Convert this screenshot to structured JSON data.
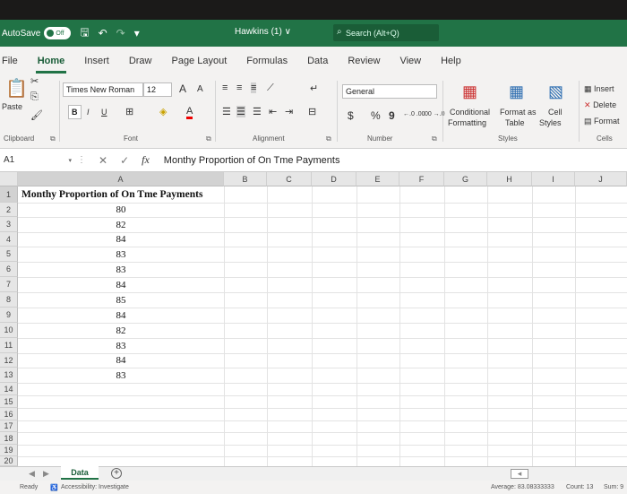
{
  "title_bar": {
    "autosave_label": "AutoSave",
    "autosave_state": "Off",
    "document_title": "Hawkins (1) ∨",
    "search_placeholder": "Search (Alt+Q)"
  },
  "ribbon_tabs": [
    "File",
    "Home",
    "Insert",
    "Draw",
    "Page Layout",
    "Formulas",
    "Data",
    "Review",
    "View",
    "Help"
  ],
  "active_tab": "Home",
  "ribbon": {
    "clipboard": {
      "paste": "Paste",
      "label": "Clipboard"
    },
    "font": {
      "name": "Times New Roman",
      "size": "12",
      "bold": "B",
      "italic": "I",
      "underline": "U",
      "grow": "A",
      "shrink": "A",
      "font_color": "A",
      "label": "Font"
    },
    "alignment": {
      "label": "Alignment"
    },
    "number": {
      "format": "General",
      "currency": "$",
      "percent": "%",
      "comma": "9",
      "inc_decimal": "←.0 .00",
      "dec_decimal": ".00 →.0",
      "label": "Number"
    },
    "styles": {
      "conditional": "Conditional",
      "conditional2": "Formatting",
      "format_as": "Format as",
      "format_as2": "Table",
      "cell": "Cell",
      "cell2": "Styles",
      "label": "Styles"
    },
    "cells": {
      "insert": "Insert",
      "delete": "Delete",
      "format": "Format",
      "label": "Cells"
    }
  },
  "formula_bar": {
    "name_box": "A1",
    "fx": "fx",
    "content": "Monthy Proportion of On Tme Payments"
  },
  "columns": [
    "A",
    "B",
    "C",
    "D",
    "E",
    "F",
    "G",
    "H",
    "I",
    "J"
  ],
  "rows": [
    "1",
    "2",
    "3",
    "4",
    "5",
    "6",
    "7",
    "8",
    "9",
    "10",
    "11",
    "12",
    "13",
    "14",
    "15",
    "16",
    "17",
    "18",
    "19",
    "20"
  ],
  "cells": {
    "a1": "Monthy Proportion of On Tme Payments",
    "values": [
      "80",
      "82",
      "84",
      "83",
      "83",
      "84",
      "85",
      "84",
      "82",
      "83",
      "84",
      "83"
    ]
  },
  "sheet_tabs": [
    "Data"
  ],
  "status_bar": {
    "ready": "Ready",
    "accessibility": "Accessibility: Investigate",
    "average": "Average: 83.08333333",
    "count": "Count: 13",
    "sum": "Sum: 9"
  },
  "colors": {
    "excel_green": "#217346",
    "active_tab_green": "#185c37"
  }
}
